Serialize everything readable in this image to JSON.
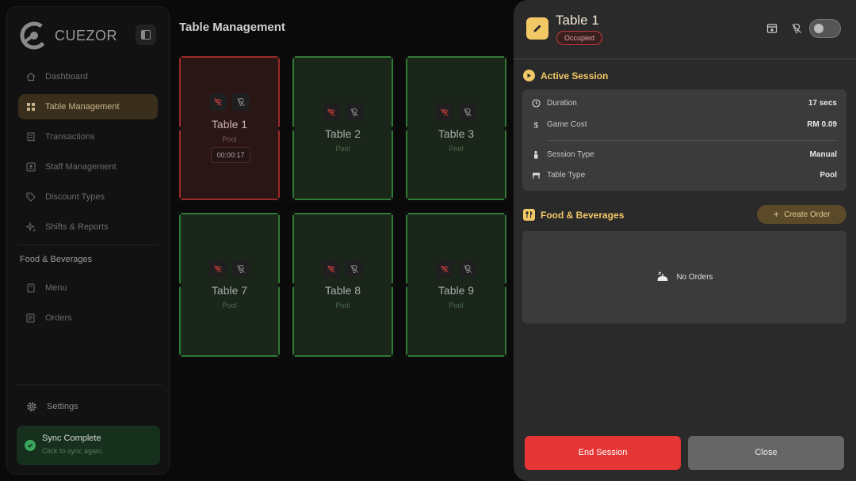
{
  "app": {
    "name": "CUEZOR"
  },
  "sidebar": {
    "items": [
      {
        "label": "Dashboard",
        "icon": "home-icon",
        "active": false
      },
      {
        "label": "Table Management",
        "icon": "grid-icon",
        "active": true
      },
      {
        "label": "Transactions",
        "icon": "receipt-icon",
        "active": false
      },
      {
        "label": "Staff Management",
        "icon": "id-card-icon",
        "active": false
      },
      {
        "label": "Discount Types",
        "icon": "tag-icon",
        "active": false
      },
      {
        "label": "Shifts & Reports",
        "icon": "sparkle-icon",
        "active": false
      }
    ],
    "section_label": "Food & Beverages",
    "fb_items": [
      {
        "label": "Menu",
        "icon": "book-icon"
      },
      {
        "label": "Orders",
        "icon": "list-icon"
      }
    ],
    "settings_label": "Settings",
    "sync": {
      "title": "Sync Complete",
      "subtitle": "Click to sync again."
    }
  },
  "main": {
    "title": "Table Management",
    "tables": [
      {
        "name": "Table 1",
        "type": "Pool",
        "status": "occupied",
        "timer": "00:00:17"
      },
      {
        "name": "Table 2",
        "type": "Pool",
        "status": "available"
      },
      {
        "name": "Table 3",
        "type": "Pool",
        "status": "available"
      },
      {
        "name": "Table 7",
        "type": "Pool",
        "status": "available"
      },
      {
        "name": "Table 8",
        "type": "Pool",
        "status": "available"
      },
      {
        "name": "Table 9",
        "type": "Pool",
        "status": "available"
      }
    ]
  },
  "panel": {
    "title": "Table 1",
    "status": "Occupied",
    "active_session": {
      "title": "Active Session",
      "rows": [
        {
          "label": "Duration",
          "value": "17 secs",
          "icon": "clock-icon"
        },
        {
          "label": "Game Cost",
          "value": "RM 0.09",
          "icon": "dollar-icon"
        },
        {
          "label": "Session Type",
          "value": "Manual",
          "icon": "hand-icon"
        },
        {
          "label": "Table Type",
          "value": "Pool",
          "icon": "table-icon"
        }
      ]
    },
    "food": {
      "title": "Food & Beverages",
      "create_label": "Create Order",
      "empty_label": "No Orders"
    },
    "end_label": "End Session",
    "close_label": "Close"
  },
  "colors": {
    "accent": "#f2c866",
    "available_border": "#2f7a35",
    "occupied_border": "#9a2b2b",
    "danger": "#e53535"
  }
}
